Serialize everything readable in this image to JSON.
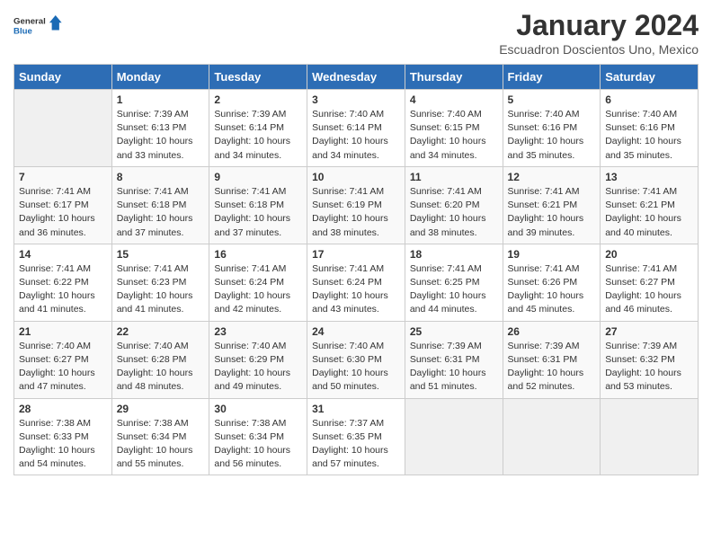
{
  "header": {
    "logo_general": "General",
    "logo_blue": "Blue",
    "title": "January 2024",
    "subtitle": "Escuadron Doscientos Uno, Mexico"
  },
  "weekdays": [
    "Sunday",
    "Monday",
    "Tuesday",
    "Wednesday",
    "Thursday",
    "Friday",
    "Saturday"
  ],
  "weeks": [
    [
      {
        "day": "",
        "info": ""
      },
      {
        "day": "1",
        "info": "Sunrise: 7:39 AM\nSunset: 6:13 PM\nDaylight: 10 hours\nand 33 minutes."
      },
      {
        "day": "2",
        "info": "Sunrise: 7:39 AM\nSunset: 6:14 PM\nDaylight: 10 hours\nand 34 minutes."
      },
      {
        "day": "3",
        "info": "Sunrise: 7:40 AM\nSunset: 6:14 PM\nDaylight: 10 hours\nand 34 minutes."
      },
      {
        "day": "4",
        "info": "Sunrise: 7:40 AM\nSunset: 6:15 PM\nDaylight: 10 hours\nand 34 minutes."
      },
      {
        "day": "5",
        "info": "Sunrise: 7:40 AM\nSunset: 6:16 PM\nDaylight: 10 hours\nand 35 minutes."
      },
      {
        "day": "6",
        "info": "Sunrise: 7:40 AM\nSunset: 6:16 PM\nDaylight: 10 hours\nand 35 minutes."
      }
    ],
    [
      {
        "day": "7",
        "info": "Sunrise: 7:41 AM\nSunset: 6:17 PM\nDaylight: 10 hours\nand 36 minutes."
      },
      {
        "day": "8",
        "info": "Sunrise: 7:41 AM\nSunset: 6:18 PM\nDaylight: 10 hours\nand 37 minutes."
      },
      {
        "day": "9",
        "info": "Sunrise: 7:41 AM\nSunset: 6:18 PM\nDaylight: 10 hours\nand 37 minutes."
      },
      {
        "day": "10",
        "info": "Sunrise: 7:41 AM\nSunset: 6:19 PM\nDaylight: 10 hours\nand 38 minutes."
      },
      {
        "day": "11",
        "info": "Sunrise: 7:41 AM\nSunset: 6:20 PM\nDaylight: 10 hours\nand 38 minutes."
      },
      {
        "day": "12",
        "info": "Sunrise: 7:41 AM\nSunset: 6:21 PM\nDaylight: 10 hours\nand 39 minutes."
      },
      {
        "day": "13",
        "info": "Sunrise: 7:41 AM\nSunset: 6:21 PM\nDaylight: 10 hours\nand 40 minutes."
      }
    ],
    [
      {
        "day": "14",
        "info": "Sunrise: 7:41 AM\nSunset: 6:22 PM\nDaylight: 10 hours\nand 41 minutes."
      },
      {
        "day": "15",
        "info": "Sunrise: 7:41 AM\nSunset: 6:23 PM\nDaylight: 10 hours\nand 41 minutes."
      },
      {
        "day": "16",
        "info": "Sunrise: 7:41 AM\nSunset: 6:24 PM\nDaylight: 10 hours\nand 42 minutes."
      },
      {
        "day": "17",
        "info": "Sunrise: 7:41 AM\nSunset: 6:24 PM\nDaylight: 10 hours\nand 43 minutes."
      },
      {
        "day": "18",
        "info": "Sunrise: 7:41 AM\nSunset: 6:25 PM\nDaylight: 10 hours\nand 44 minutes."
      },
      {
        "day": "19",
        "info": "Sunrise: 7:41 AM\nSunset: 6:26 PM\nDaylight: 10 hours\nand 45 minutes."
      },
      {
        "day": "20",
        "info": "Sunrise: 7:41 AM\nSunset: 6:27 PM\nDaylight: 10 hours\nand 46 minutes."
      }
    ],
    [
      {
        "day": "21",
        "info": "Sunrise: 7:40 AM\nSunset: 6:27 PM\nDaylight: 10 hours\nand 47 minutes."
      },
      {
        "day": "22",
        "info": "Sunrise: 7:40 AM\nSunset: 6:28 PM\nDaylight: 10 hours\nand 48 minutes."
      },
      {
        "day": "23",
        "info": "Sunrise: 7:40 AM\nSunset: 6:29 PM\nDaylight: 10 hours\nand 49 minutes."
      },
      {
        "day": "24",
        "info": "Sunrise: 7:40 AM\nSunset: 6:30 PM\nDaylight: 10 hours\nand 50 minutes."
      },
      {
        "day": "25",
        "info": "Sunrise: 7:39 AM\nSunset: 6:31 PM\nDaylight: 10 hours\nand 51 minutes."
      },
      {
        "day": "26",
        "info": "Sunrise: 7:39 AM\nSunset: 6:31 PM\nDaylight: 10 hours\nand 52 minutes."
      },
      {
        "day": "27",
        "info": "Sunrise: 7:39 AM\nSunset: 6:32 PM\nDaylight: 10 hours\nand 53 minutes."
      }
    ],
    [
      {
        "day": "28",
        "info": "Sunrise: 7:38 AM\nSunset: 6:33 PM\nDaylight: 10 hours\nand 54 minutes."
      },
      {
        "day": "29",
        "info": "Sunrise: 7:38 AM\nSunset: 6:34 PM\nDaylight: 10 hours\nand 55 minutes."
      },
      {
        "day": "30",
        "info": "Sunrise: 7:38 AM\nSunset: 6:34 PM\nDaylight: 10 hours\nand 56 minutes."
      },
      {
        "day": "31",
        "info": "Sunrise: 7:37 AM\nSunset: 6:35 PM\nDaylight: 10 hours\nand 57 minutes."
      },
      {
        "day": "",
        "info": ""
      },
      {
        "day": "",
        "info": ""
      },
      {
        "day": "",
        "info": ""
      }
    ]
  ]
}
